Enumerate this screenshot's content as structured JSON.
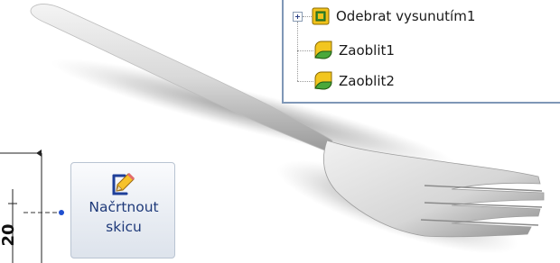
{
  "feature_tree": {
    "items": [
      {
        "label": "Odebrat vysunutím1",
        "icon": "cut-extrude-icon",
        "has_expander": true
      },
      {
        "label": "Zaoblit1",
        "icon": "fillet-icon",
        "has_expander": false
      },
      {
        "label": "Zaoblit2",
        "icon": "fillet-icon",
        "has_expander": false
      }
    ]
  },
  "sketch_button": {
    "line1": "Načrtnout",
    "line2": "skicu",
    "icon": "sketch-pencil-icon"
  },
  "dimension": {
    "value": "20"
  },
  "colors": {
    "tree_border": "#7f97b7",
    "button_text": "#1f3a7a",
    "leader_dot": "#1f4fd0",
    "fillet_yellow": "#f2c61f",
    "fillet_green": "#4aa83a"
  }
}
